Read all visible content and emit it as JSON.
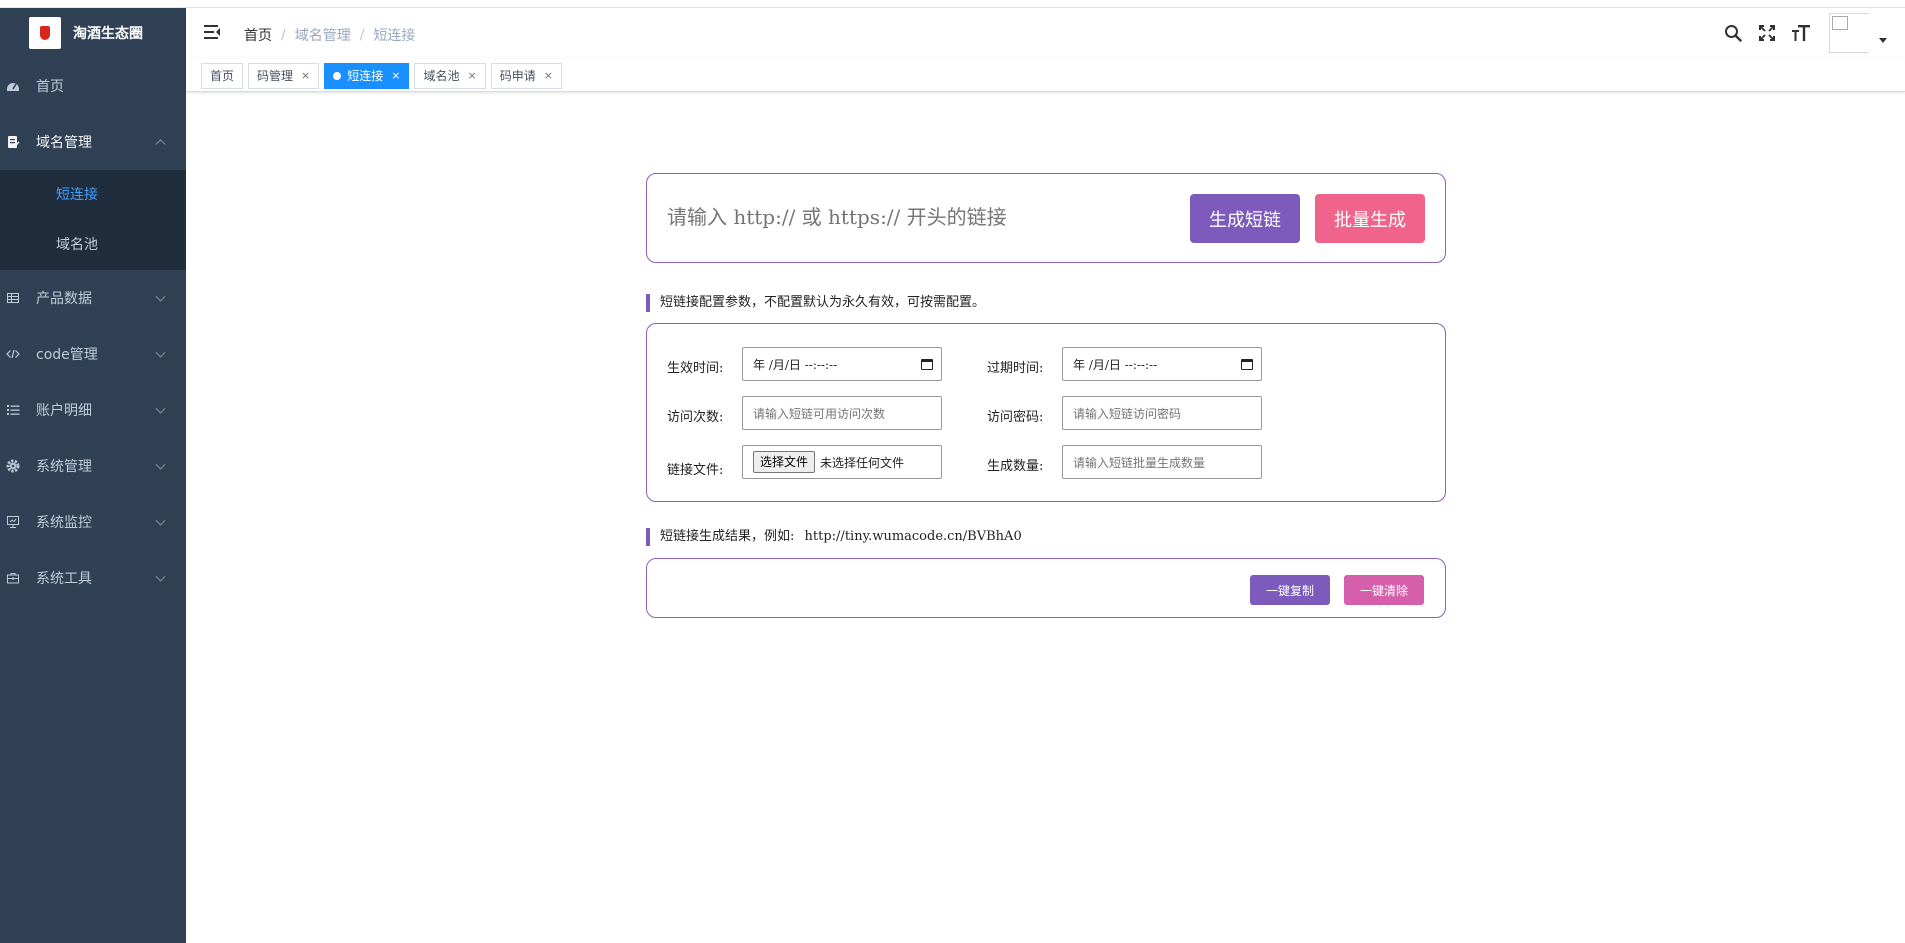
{
  "app": {
    "title": "淘酒生态圈"
  },
  "sidebar": {
    "items": [
      {
        "label": "首页",
        "icon": "dashboard-icon"
      },
      {
        "label": "域名管理",
        "icon": "document-icon",
        "open": true,
        "children": [
          {
            "label": "短连接",
            "active": true
          },
          {
            "label": "域名池"
          }
        ]
      },
      {
        "label": "产品数据",
        "icon": "table-icon"
      },
      {
        "label": "code管理",
        "icon": "code-icon"
      },
      {
        "label": "账户明细",
        "icon": "list-icon"
      },
      {
        "label": "系统管理",
        "icon": "gear-icon"
      },
      {
        "label": "系统监控",
        "icon": "monitor-icon"
      },
      {
        "label": "系统工具",
        "icon": "toolbox-icon"
      }
    ],
    "colors": {
      "bg": "#304156",
      "submenu_bg": "#1f2d3d",
      "active": "#409eff"
    }
  },
  "breadcrumb": {
    "items": [
      "首页",
      "域名管理",
      "短连接"
    ],
    "separator": "/"
  },
  "tags": [
    {
      "label": "首页",
      "closable": false
    },
    {
      "label": "码管理",
      "closable": true
    },
    {
      "label": "短连接",
      "closable": true,
      "active": true
    },
    {
      "label": "域名池",
      "closable": true
    },
    {
      "label": "码申请",
      "closable": true
    }
  ],
  "tag_close_glyph": "×",
  "shorten": {
    "placeholder": "请输入 http:// 或 https:// 开头的链接",
    "generate_label": "生成短链",
    "batch_label": "批量生成"
  },
  "config": {
    "section_title": "短链接配置参数，不配置默认为永久有效，可按需配置。",
    "fields": {
      "start_time_label": "生效时间:",
      "start_time_value": "年 /月/日 --:--:--",
      "end_time_label": "过期时间:",
      "end_time_value": "年 /月/日 --:--:--",
      "visits_label": "访问次数:",
      "visits_placeholder": "请输入短链可用访问次数",
      "password_label": "访问密码:",
      "password_placeholder": "请输入短链访问密码",
      "file_label": "链接文件:",
      "file_button": "选择文件",
      "file_status": "未选择任何文件",
      "count_label": "生成数量:",
      "count_placeholder": "请输入短链批量生成数量"
    }
  },
  "result": {
    "section_title": "短链接生成结果，例如:",
    "example_url": "http://tiny.wumacode.cn/BVBhA0",
    "copy_label": "一键复制",
    "clear_label": "一键清除"
  },
  "colors": {
    "purple": "#7c5bbd",
    "pink": "#f0648b",
    "magenta": "#d65fab",
    "tag_active": "#1890ff"
  }
}
